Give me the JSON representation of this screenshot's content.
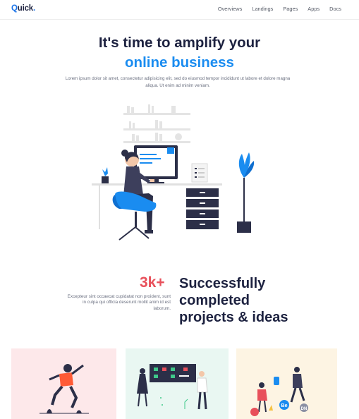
{
  "nav": {
    "logo_q": "Q",
    "logo_rest": "uick",
    "logo_dot": ".",
    "links": [
      "Overviews",
      "Landings",
      "Pages",
      "Apps",
      "Docs"
    ]
  },
  "hero": {
    "title_line1": "It's time to amplify your",
    "title_line2": "online business",
    "description": "Lorem ipsum dolor sit amet, consectetur adipisicing elit, sed do eiusmod tempor incididunt ut labore et dolore magna aliqua. Ut enim ad minim veniam."
  },
  "stats": {
    "number": "3k+",
    "description": "Excepteur sint occaecat cupidatat non proident, sunt in culpa qui officia deserunt mollit anim id est laborum.",
    "title_lines": [
      "Successfully",
      "completed",
      "projects & ideas"
    ]
  },
  "cards": {
    "card3_badges": [
      "Be",
      "DN"
    ]
  },
  "colors": {
    "brand_blue": "#1a8cf0",
    "dark_navy": "#1d2240",
    "accent_red": "#e8505b"
  }
}
